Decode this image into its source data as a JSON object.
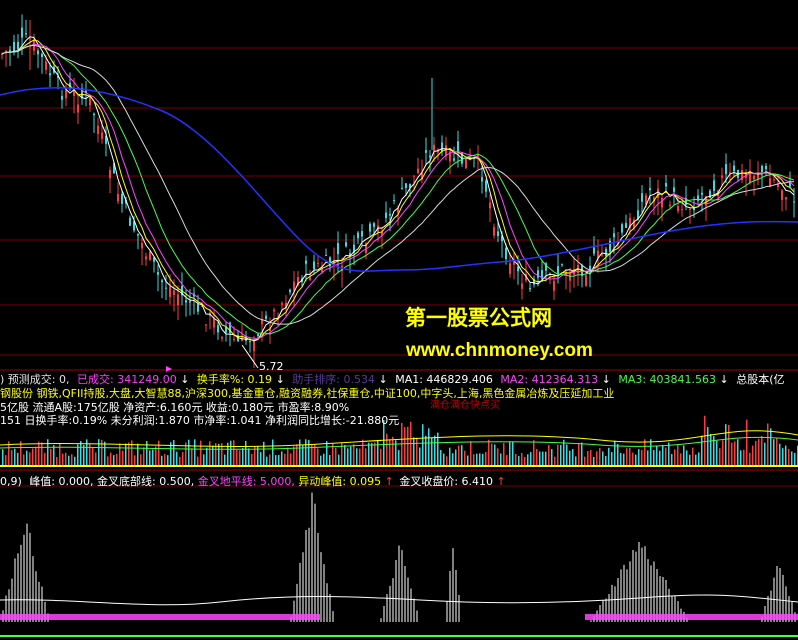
{
  "colors": {
    "background": "#000000",
    "up": "#ff3b3b",
    "down": "#31e0e6",
    "ma5": "#ffffff",
    "ma10": "#ffff00",
    "ma20": "#ff44ff",
    "ma30": "#44ff44",
    "ma60": "#d8d8d8",
    "ma120": "#2233ff",
    "grid": "#7a0000",
    "watermark": "#ffff00"
  },
  "main_panel": {
    "low_marker": "5.72"
  },
  "watermark": {
    "title": "第一股票公式网",
    "url": "www.chnmoney.com"
  },
  "volume_header": {
    "item0": ") 预测成交: 0,",
    "item1": "已成交: 341249.00",
    "item2": "换手率%: 0.19",
    "item3": "助手排序: 0.534",
    "item4": "MA1: 446829.406",
    "item5": "MA2: 412364.313",
    "item6": "MA3: 403841.563",
    "item7": "总股本(亿",
    "down_arrow": "↓"
  },
  "info_lines": {
    "sectors": "钢股份 钢铁,QFII持股,大盘,大智慧88,沪深300,基金重仓,融资融券,社保重仓,中证100,中字头,上海,黑色金属冶炼及压延加工业",
    "line2": "5亿股 流通A股:175亿股   净资产:6.160元   收益:0.180元   市盈率:8.90%",
    "line3": "151   日换手率:0.19%   未分利润:1.870   市净率:1.041   净利润同比增长:-21.880元",
    "hidden_red": "满仓满仓快点买"
  },
  "indicator_header": {
    "params": "0,9)",
    "peak": "峰值: 0.000,",
    "bottom_line": "金叉底部线: 0.500,",
    "ground_line": "金叉地平线: 5.000,",
    "abnormal_peak": "异动峰值: 0.095",
    "close_price": "金叉收盘价: 6.410",
    "up_arrow": "↑"
  }
}
